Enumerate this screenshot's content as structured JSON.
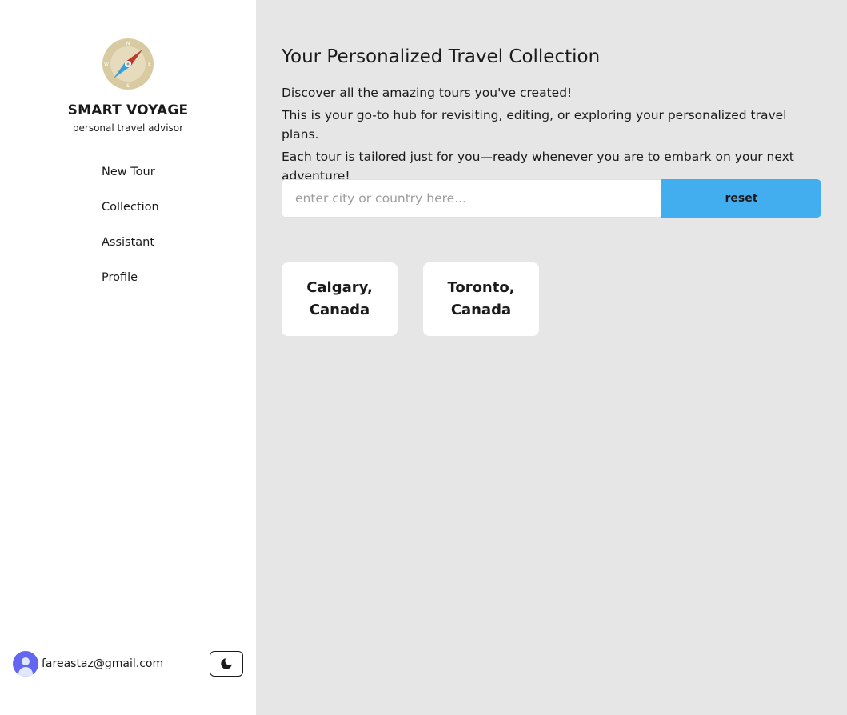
{
  "sidebar": {
    "brand": "SMART VOYAGE",
    "tagline": "personal travel advisor",
    "nav": [
      {
        "label": "New Tour"
      },
      {
        "label": "Collection"
      },
      {
        "label": "Assistant"
      },
      {
        "label": "Profile"
      }
    ],
    "user_email": "fareastaz@gmail.com"
  },
  "main": {
    "title": "Your Personalized Travel Collection",
    "intro": [
      "Discover all the amazing tours you've created!",
      "This is your go-to hub for revisiting, editing, or exploring your personalized travel plans.",
      "Each tour is tailored just for you—ready whenever you are to embark on your next adventure!"
    ],
    "search": {
      "placeholder": "enter city or country here...",
      "value": "",
      "reset_label": "reset"
    },
    "tours": [
      {
        "city": "Calgary,",
        "country": "Canada"
      },
      {
        "city": "Toronto,",
        "country": "Canada"
      }
    ]
  },
  "colors": {
    "accent": "#42adef",
    "main_background": "#e6e6e6",
    "sidebar_background": "#ffffff",
    "avatar": "#6366f1"
  },
  "icons": {
    "logo": "compass-icon",
    "theme_toggle": "moon-icon",
    "avatar": "user-avatar-icon"
  }
}
